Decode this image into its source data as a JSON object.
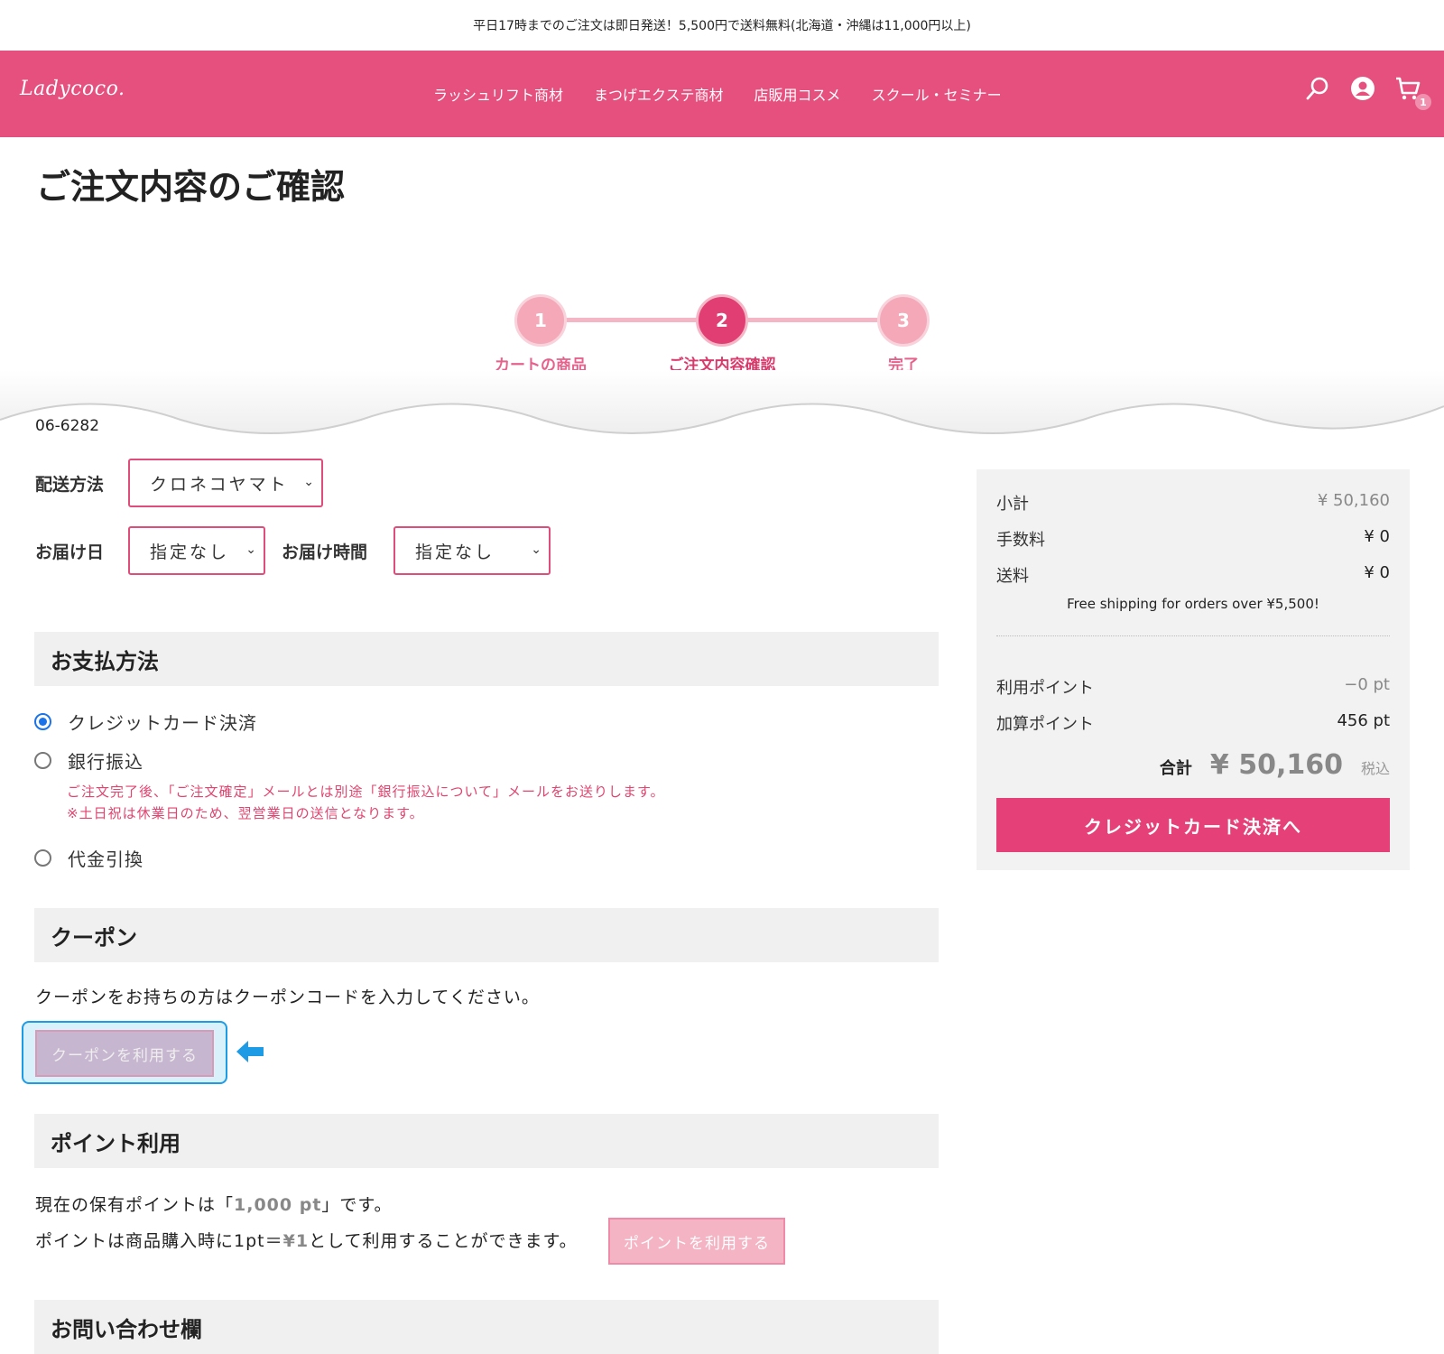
{
  "announcement": "平日17時までのご注文は即日発送！5,500円で送料無料(北海道・沖縄は11,000円以上)",
  "header": {
    "logo": "Ladycoco.",
    "nav": [
      "ラッシュリフト商材",
      "まつげエクステ商材",
      "店販用コスメ",
      "スクール・セミナー"
    ],
    "cart_count": "1",
    "icons": [
      "search-icon",
      "user-icon",
      "cart-icon"
    ],
    "brand_color": "#e5507f"
  },
  "page_title": "ご注文内容のご確認",
  "steps": [
    {
      "num": "1",
      "label": "カートの商品",
      "active": false
    },
    {
      "num": "2",
      "label": "ご注文内容確認",
      "active": true
    },
    {
      "num": "3",
      "label": "完了",
      "active": false
    }
  ],
  "partial_phone": "06-6282",
  "delivery": {
    "method_label": "配送方法",
    "method_value": "クロネコヤマト",
    "date_label": "お届け日",
    "date_value": "指定なし",
    "time_label": "お届け時間",
    "time_value": "指定なし"
  },
  "payment": {
    "title": "お支払方法",
    "options": [
      {
        "label": "クレジットカード決済",
        "checked": true
      },
      {
        "label": "銀行振込",
        "checked": false
      },
      {
        "label": "代金引換",
        "checked": false
      }
    ],
    "bank_note_1": "ご注文完了後、「ご注文確定」メールとは別途「銀行振込について」メールをお送りします。",
    "bank_note_2": "※土日祝は休業日のため、翌営業日の送信となります。"
  },
  "coupon": {
    "title": "クーポン",
    "text": "クーポンをお持ちの方はクーポンコードを入力してください。",
    "button": "クーポンを利用する"
  },
  "points": {
    "title": "ポイント利用",
    "line1_pre": "現在の保有ポイントは「",
    "line1_value": "1,000 pt",
    "line1_post": "」です。",
    "line2_pre": "ポイントは商品購入時に1pt＝",
    "line2_value": "¥1",
    "line2_post": "として利用することができます。",
    "button": "ポイントを利用する"
  },
  "inquiry": {
    "title": "お問い合わせ欄"
  },
  "summary": {
    "subtotal_label": "小計",
    "subtotal": "¥ 50,160",
    "fee_label": "手数料",
    "fee": "¥ 0",
    "shipping_label": "送料",
    "shipping": "¥ 0",
    "free_note": "Free shipping for orders over ¥5,500!",
    "used_points_label": "利用ポイント",
    "used_points": "−0 pt",
    "earned_points_label": "加算ポイント",
    "earned_points": "456 pt",
    "total_label": "合計",
    "total": "¥ 50,160",
    "tax_label": "税込",
    "pay_button": "クレジットカード決済へ"
  }
}
